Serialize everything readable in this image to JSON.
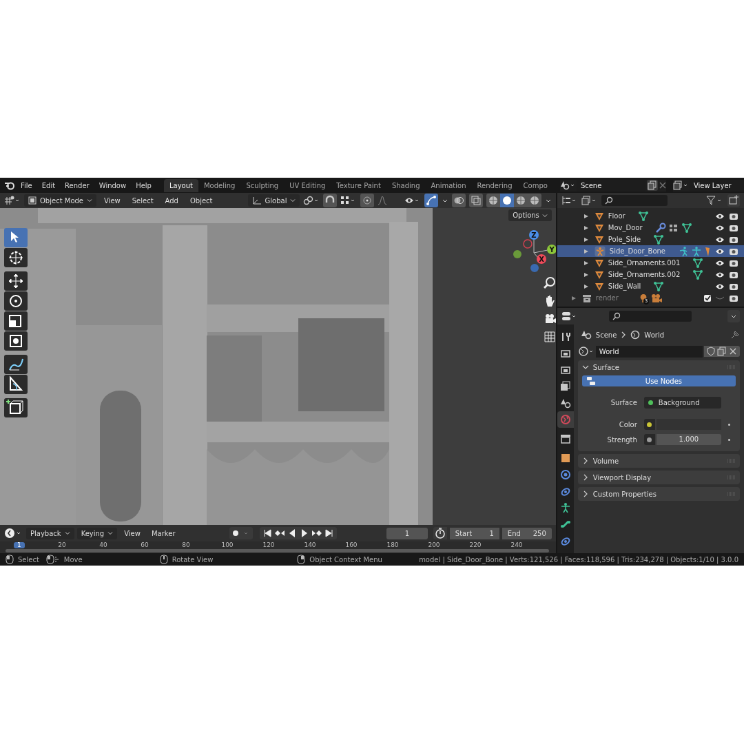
{
  "top_bar": {
    "menus": [
      "File",
      "Edit",
      "Render",
      "Window",
      "Help"
    ],
    "workspaces": [
      {
        "label": "Layout",
        "selected": true
      },
      {
        "label": "Modeling",
        "selected": false
      },
      {
        "label": "Sculpting",
        "selected": false
      },
      {
        "label": "UV Editing",
        "selected": false
      },
      {
        "label": "Texture Paint",
        "selected": false
      },
      {
        "label": "Shading",
        "selected": false
      },
      {
        "label": "Animation",
        "selected": false
      },
      {
        "label": "Rendering",
        "selected": false
      },
      {
        "label": "Compo",
        "selected": false
      }
    ],
    "scene": "Scene",
    "view_layer": "View Layer"
  },
  "viewport": {
    "mode": "Object Mode",
    "menus": [
      "View",
      "Select",
      "Add",
      "Object"
    ],
    "orientation": "Global",
    "snapping": true,
    "gizmos": true,
    "shading": [
      {
        "selected": false
      },
      {
        "selected": true
      },
      {
        "selected": false
      },
      {
        "selected": false
      }
    ],
    "options": "Options",
    "gizmo_axes": [
      "Z",
      "Y",
      "X"
    ],
    "tools": [
      {
        "selected": true
      },
      {
        "selected": false
      },
      {
        "selected": false
      },
      {
        "selected": false
      },
      {
        "selected": false
      },
      {
        "selected": false
      },
      {
        "selected": false
      },
      {
        "selected": false
      },
      {
        "selected": false
      }
    ]
  },
  "outliner": {
    "rows": [
      {
        "name": "Floor",
        "kind": "object",
        "selected": false,
        "data": [
          {
            "kind": "mesh"
          }
        ]
      },
      {
        "name": "Mov_Door",
        "kind": "object",
        "selected": false,
        "data": [
          {
            "kind": "wrench"
          },
          {
            "kind": "lattice"
          },
          {
            "kind": "mesh"
          }
        ]
      },
      {
        "name": "Pole_Side",
        "kind": "object",
        "selected": false,
        "data": [
          {
            "kind": "mesh"
          }
        ]
      },
      {
        "name": "Side_Door_Bone",
        "kind": "armature",
        "selected": true,
        "data": [
          {
            "kind": "pose"
          },
          {
            "kind": "armature"
          },
          {
            "kind": "bone"
          }
        ]
      },
      {
        "name": "Side_Ornaments.001",
        "kind": "object",
        "selected": false,
        "data": [
          {
            "kind": "mesh"
          }
        ]
      },
      {
        "name": "Side_Ornaments.002",
        "kind": "object",
        "selected": false,
        "data": [
          {
            "kind": "mesh"
          }
        ]
      },
      {
        "name": "Side_Wall",
        "kind": "object",
        "selected": false,
        "data": [
          {
            "kind": "mesh"
          }
        ]
      }
    ],
    "collection": {
      "name": "render",
      "badge": "3",
      "checked": true,
      "data": [
        {
          "kind": "light"
        },
        {
          "kind": "camera"
        }
      ]
    }
  },
  "properties": {
    "breadcrumb": [
      "Scene",
      "World"
    ],
    "datablock": "World",
    "tabs": [
      {
        "kind": "tool",
        "selected": false
      },
      {
        "kind": "render",
        "selected": false
      },
      {
        "kind": "output",
        "selected": false
      },
      {
        "kind": "view_layer",
        "selected": false
      },
      {
        "kind": "scene",
        "selected": false
      },
      {
        "kind": "world",
        "selected": true
      },
      {
        "kind": "collection",
        "selected": false
      },
      {
        "kind": "object",
        "selected": false
      },
      {
        "kind": "physics",
        "selected": false
      },
      {
        "kind": "constraints",
        "selected": false
      },
      {
        "kind": "armature_data",
        "selected": false
      },
      {
        "kind": "bone",
        "selected": false
      },
      {
        "kind": "bone_constraints",
        "selected": false
      }
    ],
    "panels": [
      {
        "title": "Surface",
        "expanded": true,
        "use_nodes": "Use Nodes",
        "fields": [
          {
            "kind": "link",
            "label": "Surface",
            "value": "Background",
            "color": "#4fbf5a"
          },
          {
            "kind": "color",
            "label": "Color",
            "color": "#c9c436"
          },
          {
            "kind": "number",
            "label": "Strength",
            "value": "1.000",
            "color": "#9a9a9a"
          }
        ]
      },
      {
        "title": "Volume",
        "expanded": false
      },
      {
        "title": "Viewport Display",
        "expanded": false
      },
      {
        "title": "Custom Properties",
        "expanded": false
      }
    ]
  },
  "timeline": {
    "menus": [
      "Playback",
      "Keying",
      "View",
      "Marker"
    ],
    "current_frame": "1",
    "start_label": "Start",
    "start": "1",
    "end_label": "End",
    "end": "250",
    "playhead": "1",
    "ruler": [
      "20",
      "40",
      "60",
      "80",
      "100",
      "120",
      "140",
      "160",
      "180",
      "200",
      "220",
      "240"
    ]
  },
  "status_bar": {
    "hints": [
      {
        "kind": "left",
        "label": "Select"
      },
      {
        "kind": "drag",
        "label": "Move"
      },
      {
        "kind": "middle",
        "label": "Rotate View"
      },
      {
        "kind": "right",
        "label": "Object Context Menu"
      }
    ],
    "stats": "model | Side_Door_Bone | Verts:121,526 | Faces:118,596 | Tris:234,278 | Objects:1/10 | 3.0.0"
  }
}
